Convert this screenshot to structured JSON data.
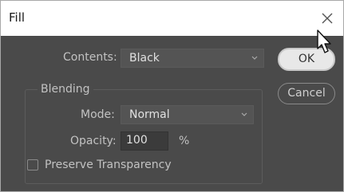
{
  "window": {
    "title": "Fill",
    "close_icon": "close-icon"
  },
  "contents": {
    "label": "Contents:",
    "value": "Black"
  },
  "blending": {
    "group_label": "Blending",
    "mode_label": "Mode:",
    "mode_value": "Normal",
    "opacity_label": "Opacity:",
    "opacity_value": "100",
    "opacity_unit": "%"
  },
  "preserve_transparency": {
    "label": "Preserve Transparency",
    "checked": false
  },
  "buttons": {
    "ok": "OK",
    "cancel": "Cancel"
  },
  "colors": {
    "dialog_bg": "#4a4a4a",
    "titlebar_bg": "#ffffff",
    "ok_button_bg": "#e8e8e8"
  }
}
